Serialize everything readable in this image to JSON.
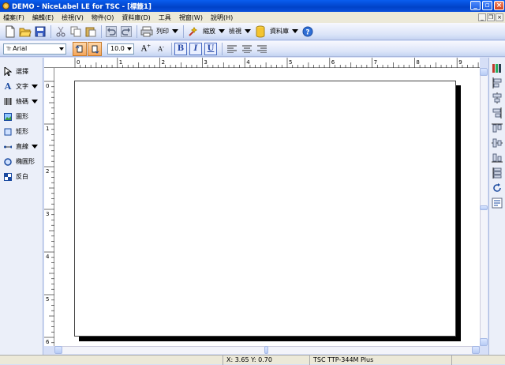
{
  "window": {
    "title": "DEMO - NiceLabel LE for TSC - [標籤1]"
  },
  "menu": [
    "檔案(F)",
    "編輯(E)",
    "檢視(V)",
    "物件(O)",
    "資料庫(D)",
    "工具",
    "視窗(W)",
    "說明(H)"
  ],
  "toolbar1": {
    "print_label": "列印",
    "zoom_label": "縮放",
    "view_label": "檢視",
    "database_label": "資料庫"
  },
  "toolbar2": {
    "font_name": "Arial",
    "font_size": "10.0",
    "bold": "B",
    "italic": "I",
    "underline": "U"
  },
  "tools": [
    {
      "label": "選擇"
    },
    {
      "label": "文字"
    },
    {
      "label": "條碼"
    },
    {
      "label": "圖形"
    },
    {
      "label": "矩形"
    },
    {
      "label": "直線"
    },
    {
      "label": "橢圓形"
    },
    {
      "label": "反白"
    }
  ],
  "ruler": {
    "top_marks": [
      "0",
      "1",
      "2",
      "3",
      "4",
      "5",
      "6",
      "7",
      "8",
      "9"
    ],
    "left_marks": [
      "0",
      "1",
      "2",
      "3",
      "4",
      "5",
      "6"
    ]
  },
  "status": {
    "coords": "X:  3.65 Y:  0.70",
    "printer": "TSC  TTP-344M Plus"
  },
  "colors": {
    "titlebar": "#0a5ef0",
    "workspace": "#ffffff",
    "shadow": "#000000"
  }
}
